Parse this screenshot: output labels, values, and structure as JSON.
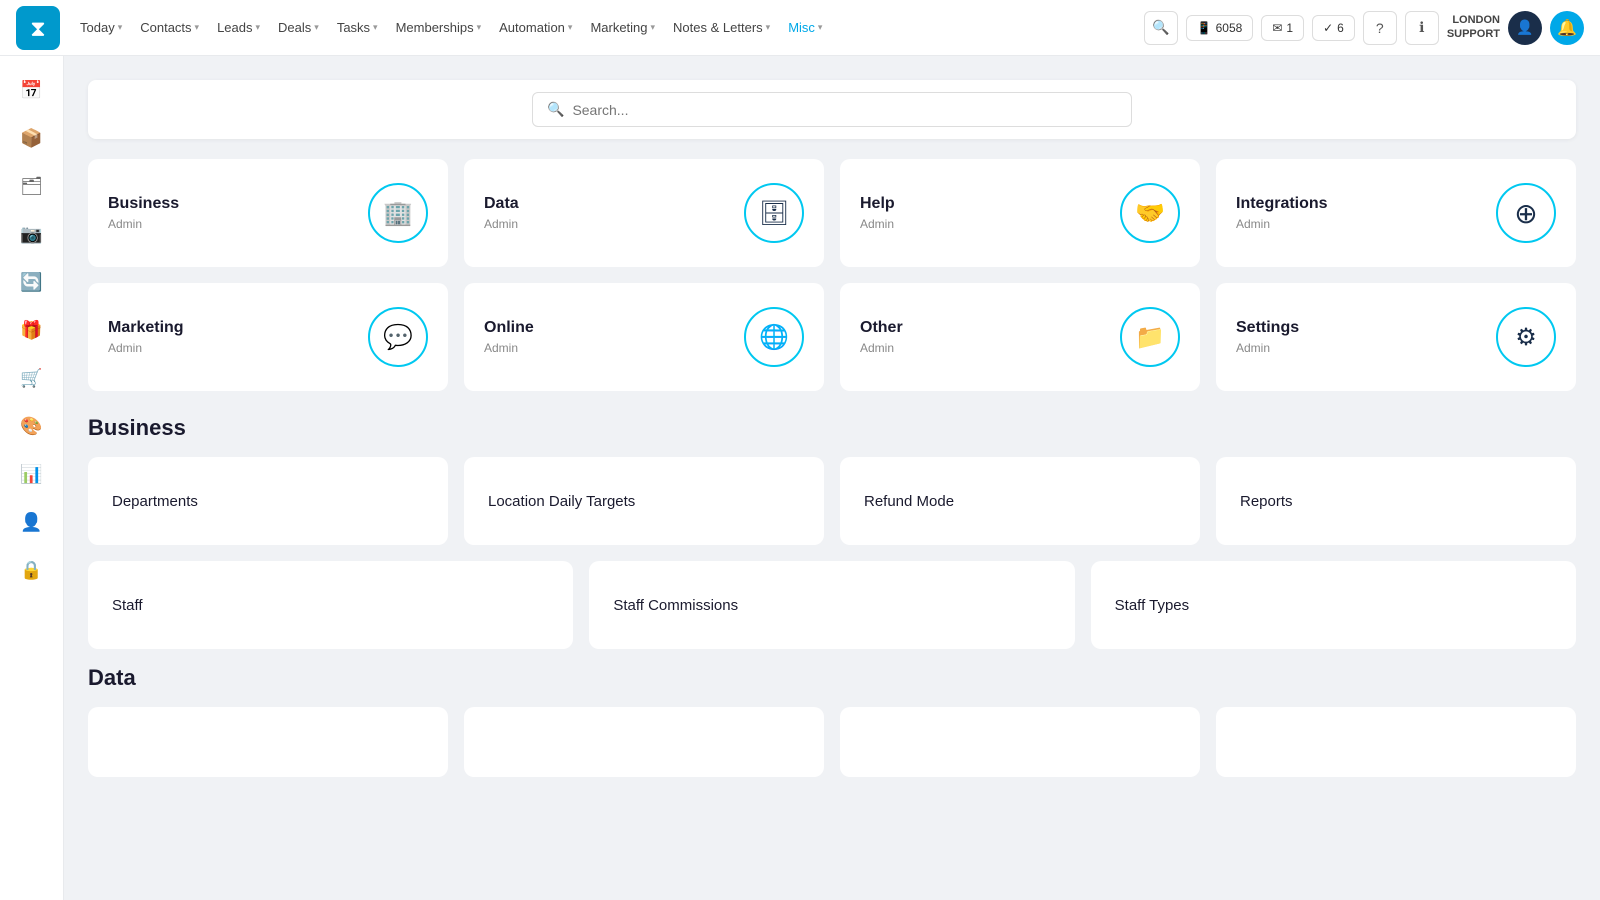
{
  "nav": {
    "items": [
      {
        "label": "Today",
        "hasChevron": true,
        "active": false
      },
      {
        "label": "Contacts",
        "hasChevron": true,
        "active": false
      },
      {
        "label": "Leads",
        "hasChevron": true,
        "active": false
      },
      {
        "label": "Deals",
        "hasChevron": true,
        "active": false
      },
      {
        "label": "Tasks",
        "hasChevron": true,
        "active": false
      },
      {
        "label": "Memberships",
        "hasChevron": true,
        "active": false
      },
      {
        "label": "Automation",
        "hasChevron": true,
        "active": false
      },
      {
        "label": "Marketing",
        "hasChevron": true,
        "active": false
      },
      {
        "label": "Notes & Letters",
        "hasChevron": true,
        "active": false
      },
      {
        "label": "Misc",
        "hasChevron": true,
        "active": true
      }
    ],
    "phone_number": "6058",
    "email_count": "1",
    "task_count": "6",
    "london_line1": "LONDON",
    "london_line2": "SUPPORT"
  },
  "sidebar": {
    "items": [
      {
        "icon": "📅",
        "name": "calendar"
      },
      {
        "icon": "📦",
        "name": "box"
      },
      {
        "icon": "🗂",
        "name": "folders"
      },
      {
        "icon": "📷",
        "name": "camera"
      },
      {
        "icon": "🔄",
        "name": "history"
      },
      {
        "icon": "🎁",
        "name": "gift"
      },
      {
        "icon": "🛒",
        "name": "cart"
      },
      {
        "icon": "🎨",
        "name": "design"
      },
      {
        "icon": "📊",
        "name": "reports"
      },
      {
        "icon": "👤",
        "name": "user"
      },
      {
        "icon": "🔒",
        "name": "lock"
      }
    ]
  },
  "search": {
    "placeholder": "Search..."
  },
  "top_cards": [
    {
      "title": "Business",
      "subtitle": "Admin",
      "icon": "🏢",
      "name": "business"
    },
    {
      "title": "Data",
      "subtitle": "Admin",
      "icon": "🗄",
      "name": "data"
    },
    {
      "title": "Help",
      "subtitle": "Admin",
      "icon": "🤝",
      "name": "help"
    },
    {
      "title": "Integrations",
      "subtitle": "Admin",
      "icon": "⊕",
      "name": "integrations"
    },
    {
      "title": "Marketing",
      "subtitle": "Admin",
      "icon": "💬",
      "name": "marketing"
    },
    {
      "title": "Online",
      "subtitle": "Admin",
      "icon": "🌐",
      "name": "online"
    },
    {
      "title": "Other",
      "subtitle": "Admin",
      "icon": "📁",
      "name": "other"
    },
    {
      "title": "Settings",
      "subtitle": "Admin",
      "icon": "⚙",
      "name": "settings"
    }
  ],
  "sections": [
    {
      "title": "Business",
      "cards_row1": [
        {
          "label": "Departments",
          "name": "departments"
        },
        {
          "label": "Location Daily Targets",
          "name": "location-daily-targets"
        },
        {
          "label": "Refund Mode",
          "name": "refund-mode"
        },
        {
          "label": "Reports",
          "name": "reports"
        }
      ],
      "cards_row2": [
        {
          "label": "Staff",
          "name": "staff"
        },
        {
          "label": "Staff Commissions",
          "name": "staff-commissions"
        },
        {
          "label": "Staff Types",
          "name": "staff-types"
        }
      ]
    },
    {
      "title": "Data",
      "cards_row1": [],
      "cards_row2": []
    }
  ]
}
